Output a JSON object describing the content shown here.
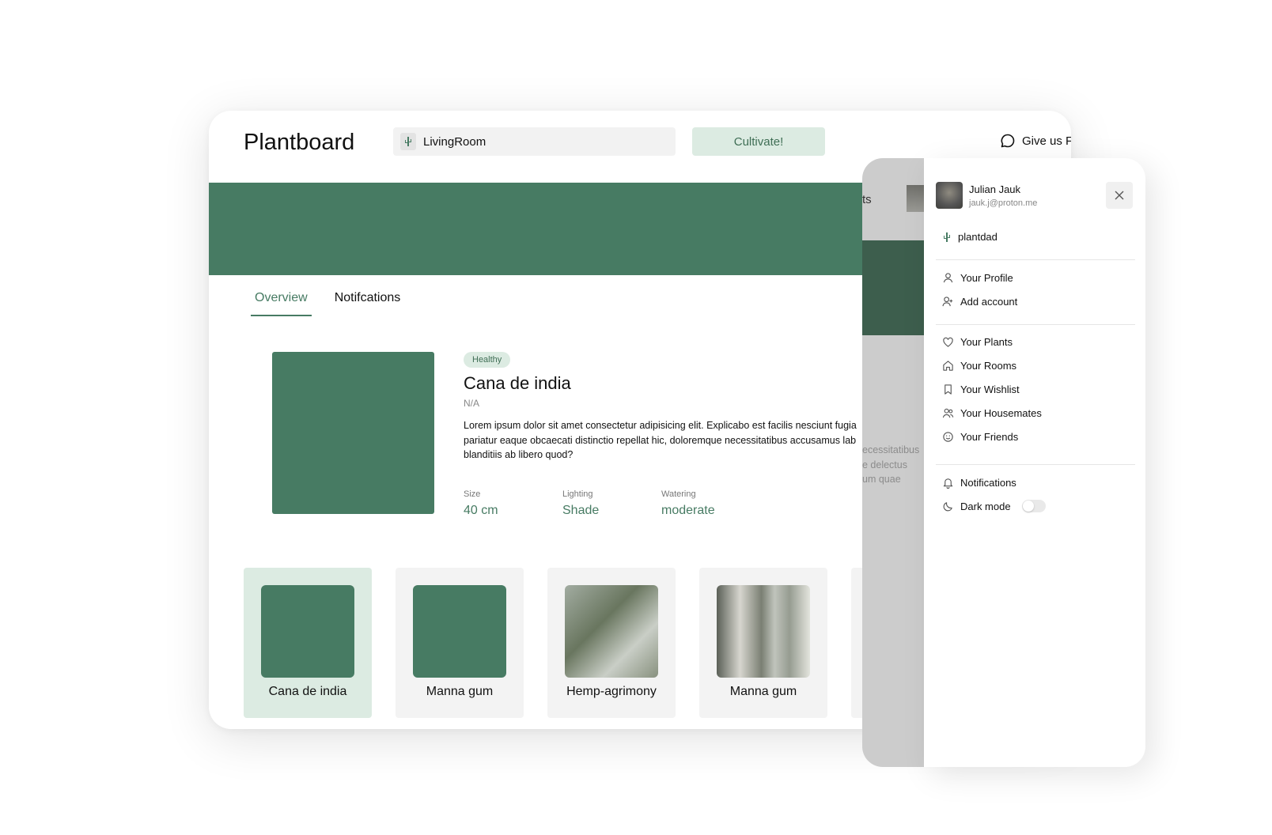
{
  "app": {
    "title": "Plantboard"
  },
  "header": {
    "room_value": "LivingRoom",
    "cultivate_label": "Cultivate!",
    "feedback_label": "Give us Fe"
  },
  "tabs": [
    {
      "label": "Overview",
      "active": true
    },
    {
      "label": "Notifcations",
      "active": false
    }
  ],
  "plant": {
    "status": "Healthy",
    "name": "Cana de india",
    "subtitle": "N/A",
    "description": "Lorem ipsum dolor sit amet consectetur adipisicing elit. Explicabo est facilis nesciunt fugia\npariatur eaque obcaecati distinctio repellat hic, doloremque necessitatibus accusamus lab\nblanditiis ab libero quod?",
    "stats": [
      {
        "label": "Size",
        "value": "40 cm"
      },
      {
        "label": "Lighting",
        "value": "Shade"
      },
      {
        "label": "Watering",
        "value": "moderate"
      }
    ]
  },
  "plant_cards": [
    {
      "label": "Cana de india",
      "selected": true,
      "thumb": "green"
    },
    {
      "label": "Manna gum",
      "selected": false,
      "thumb": "green"
    },
    {
      "label": "Hemp-agrimony",
      "selected": false,
      "thumb": "photo-1"
    },
    {
      "label": "Manna gum",
      "selected": false,
      "thumb": "photo-2"
    }
  ],
  "overlay": {
    "top_text": "ts",
    "text_lines": "ecessitatibus\ne delectus\num quae"
  },
  "menu": {
    "user_name": "Julian Jauk",
    "user_email": "jauk.j@proton.me",
    "account_name": "plantdad",
    "group_account": [
      {
        "label": "Your Profile",
        "icon": "user-icon"
      },
      {
        "label": "Add account",
        "icon": "user-plus-icon"
      }
    ],
    "group_collections": [
      {
        "label": "Your Plants",
        "icon": "heart-icon"
      },
      {
        "label": "Your Rooms",
        "icon": "home-icon"
      },
      {
        "label": "Your Wishlist",
        "icon": "bookmark-icon"
      },
      {
        "label": "Your Housemates",
        "icon": "users-icon"
      },
      {
        "label": "Your Friends",
        "icon": "smile-icon"
      }
    ],
    "notifications_label": "Notifications",
    "dark_mode_label": "Dark mode",
    "dark_mode_on": false
  },
  "colors": {
    "brand_green": "#477b63",
    "light_green": "#dcebe2",
    "dark_green": "#3d5e4d"
  }
}
